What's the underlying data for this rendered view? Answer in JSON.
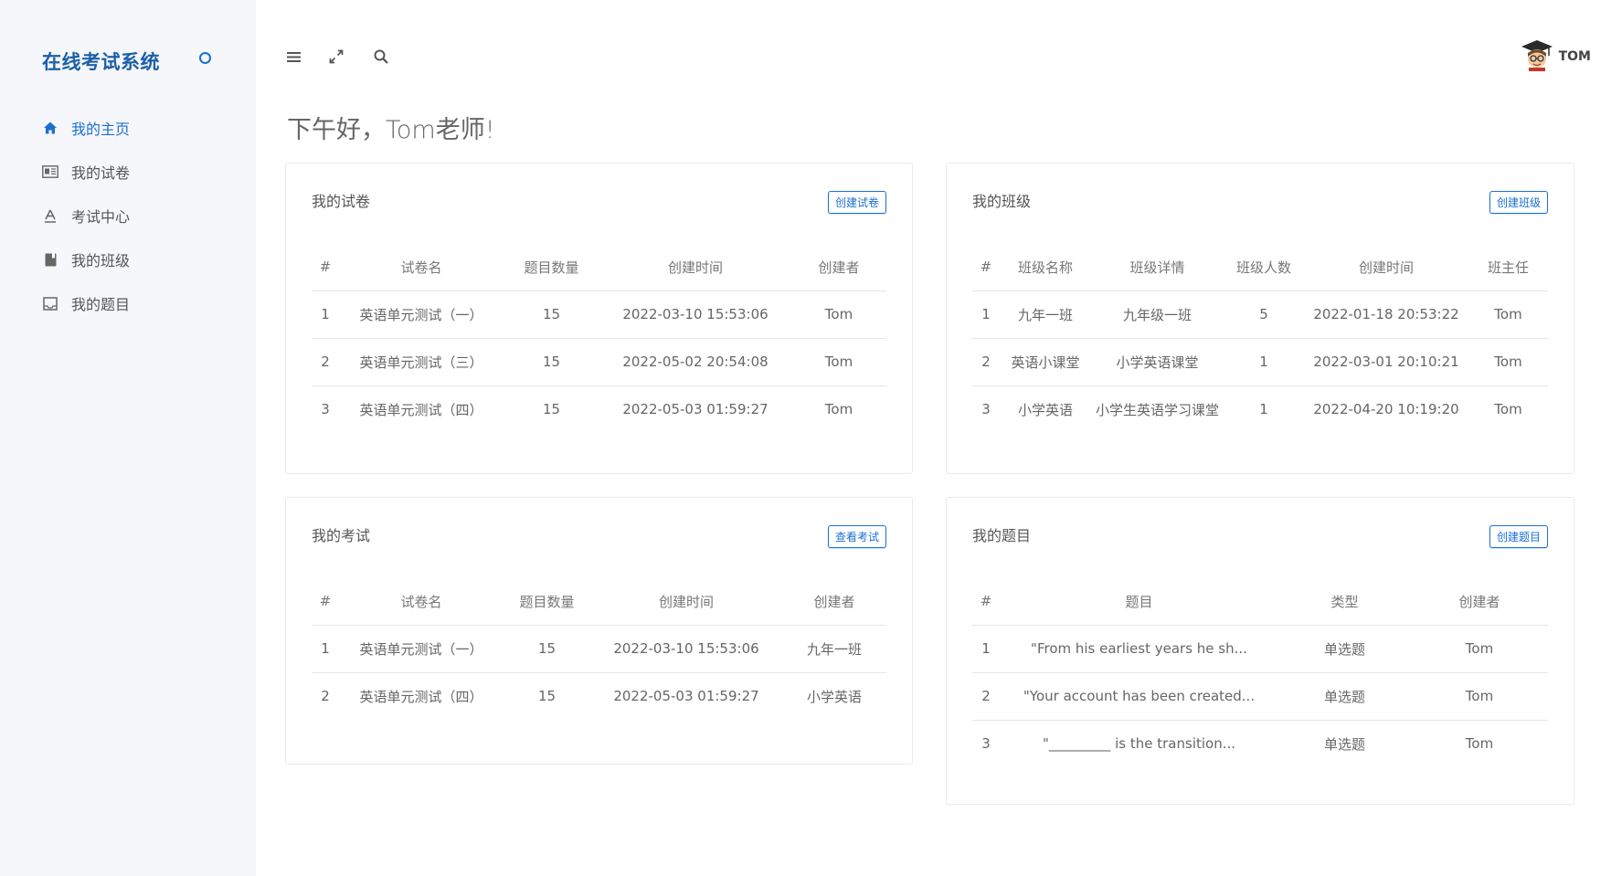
{
  "app": {
    "title": "在线考试系统"
  },
  "nav": {
    "items": [
      {
        "label": "我的主页",
        "icon": "home-icon",
        "active": true
      },
      {
        "label": "我的试卷",
        "icon": "paper-icon",
        "active": false
      },
      {
        "label": "考试中心",
        "icon": "exam-icon",
        "active": false
      },
      {
        "label": "我的班级",
        "icon": "book-icon",
        "active": false
      },
      {
        "label": "我的题目",
        "icon": "inbox-icon",
        "active": false
      }
    ]
  },
  "user": {
    "name": "TOM"
  },
  "greeting": "下午好，Tom老师!",
  "colors": {
    "accent": "#1c6fd1",
    "brand": "#1c5fa8",
    "sidebar_bg": "#f5f7fa"
  },
  "papers": {
    "title": "我的试卷",
    "button": "创建试卷",
    "headers": [
      "#",
      "试卷名",
      "题目数量",
      "创建时间",
      "创建者"
    ],
    "rows": [
      [
        "1",
        "英语单元测试（一）",
        "15",
        "2022-03-10 15:53:06",
        "Tom"
      ],
      [
        "2",
        "英语单元测试（三）",
        "15",
        "2022-05-02 20:54:08",
        "Tom"
      ],
      [
        "3",
        "英语单元测试（四）",
        "15",
        "2022-05-03 01:59:27",
        "Tom"
      ]
    ]
  },
  "classes": {
    "title": "我的班级",
    "button": "创建班级",
    "headers": [
      "#",
      "班级名称",
      "班级详情",
      "班级人数",
      "创建时间",
      "班主任"
    ],
    "rows": [
      [
        "1",
        "九年一班",
        "九年级一班",
        "5",
        "2022-01-18 20:53:22",
        "Tom"
      ],
      [
        "2",
        "英语小课堂",
        "小学英语课堂",
        "1",
        "2022-03-01 20:10:21",
        "Tom"
      ],
      [
        "3",
        "小学英语",
        "小学生英语学习课堂",
        "1",
        "2022-04-20 10:19:20",
        "Tom"
      ]
    ]
  },
  "exams": {
    "title": "我的考试",
    "button": "查看考试",
    "headers": [
      "#",
      "试卷名",
      "题目数量",
      "创建时间",
      "创建者"
    ],
    "rows": [
      [
        "1",
        "英语单元测试（一）",
        "15",
        "2022-03-10 15:53:06",
        "九年一班"
      ],
      [
        "2",
        "英语单元测试（四）",
        "15",
        "2022-05-03 01:59:27",
        "小学英语"
      ]
    ]
  },
  "questions": {
    "title": "我的题目",
    "button": "创建题目",
    "headers": [
      "#",
      "题目",
      "类型",
      "创建者"
    ],
    "rows": [
      [
        "1",
        "\"From his earliest years he sh...",
        "单选题",
        "Tom"
      ],
      [
        "2",
        "\"Your account has been created...",
        "单选题",
        "Tom"
      ],
      [
        "3",
        "\"_________ is the transition...",
        "单选题",
        "Tom"
      ]
    ]
  }
}
